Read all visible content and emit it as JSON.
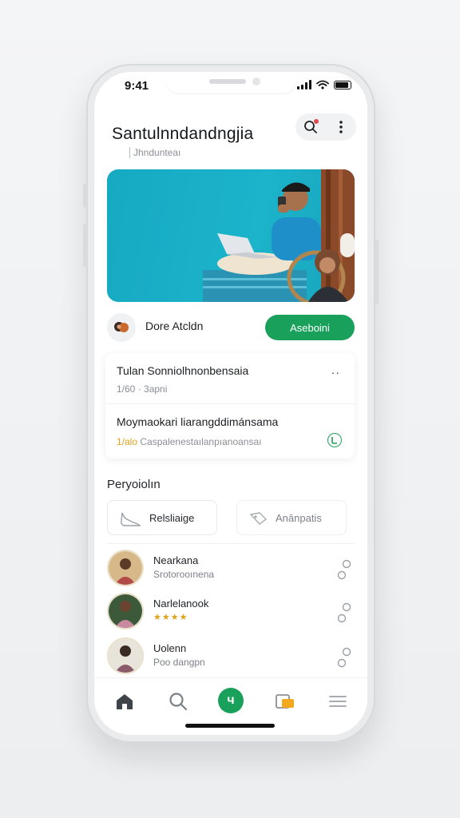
{
  "status_bar": {
    "time": "9:41"
  },
  "header": {
    "title": "Santulnndandngjia",
    "subtitle": "Jhndunteaı"
  },
  "hero": {
    "image": "person-with-laptop-and-phone-photo"
  },
  "author": {
    "name": "Dore Atcldn",
    "button_label": "Aseboini"
  },
  "card": {
    "rows": [
      {
        "title": "Tulan Sonniolhnonbensaia",
        "meta": "1/60 · 3apni"
      },
      {
        "title": "Moymaokari liarangddimánsama",
        "meta_accent": "1/alo",
        "meta": "Caspalenestaılanpıanoansaı"
      }
    ]
  },
  "section": {
    "title": "Peryoiolın",
    "segments": [
      {
        "label": "Relsliaige",
        "icon": "shoe-icon"
      },
      {
        "label": "Anānpatis",
        "icon": "tag-icon"
      }
    ]
  },
  "people": [
    {
      "name": "Nearkana",
      "sub": "Srotorooınena"
    },
    {
      "name": "Narlelanook",
      "sub": "★★★★"
    },
    {
      "name": "Uolenn",
      "sub": "Poo dangpn"
    }
  ],
  "tabbar": {
    "items": [
      "home-icon",
      "search-icon",
      "add-icon",
      "folder-icon",
      "menu-icon"
    ],
    "fab_label": "ч"
  },
  "colors": {
    "accent": "#19a05a",
    "hero_bg": "#16a9c2",
    "star": "#e0a319",
    "badge": "#e5484d"
  }
}
